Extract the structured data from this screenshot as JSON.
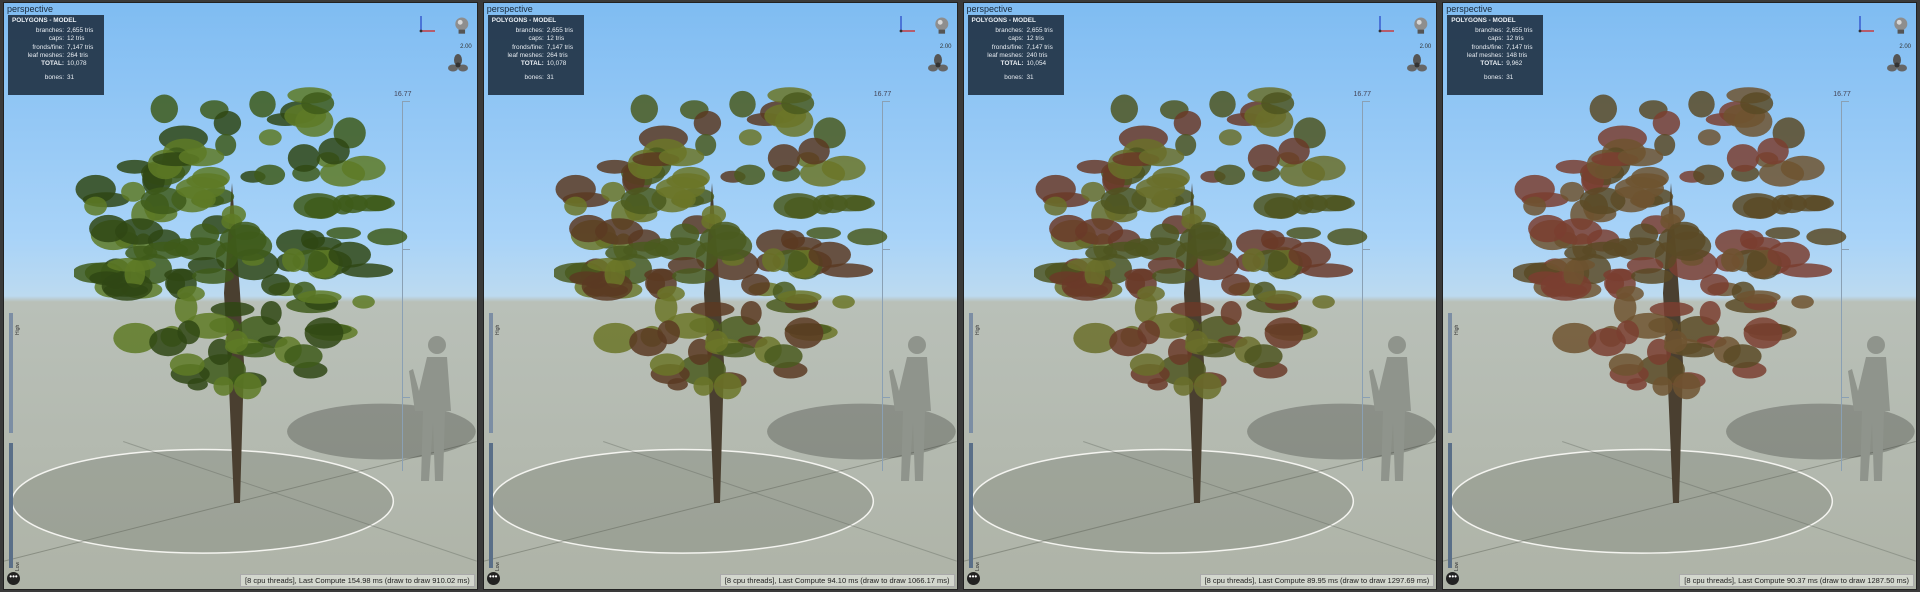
{
  "viewports": [
    {
      "title": "perspective",
      "stats": {
        "header": "POLYGONS - MODEL",
        "rows": [
          {
            "k": "branches:",
            "v": "2,655 tris"
          },
          {
            "k": "caps:",
            "v": "12 tris"
          },
          {
            "k": "fronds/fine:",
            "v": "7,147 tris"
          },
          {
            "k": "leaf meshes:",
            "v": "264 tris"
          },
          {
            "k": "TOTAL:",
            "v": "10,078"
          }
        ],
        "bones_k": "bones:",
        "bones_v": "31"
      },
      "zoom": "2.00",
      "ruler_value": "16.77",
      "high_label": "High",
      "low_label": "Low",
      "status": "[8 cpu threads], Last Compute 154.98 ms (draw to draw 910.02 ms)",
      "foliage_colors": [
        "#3e5a1a",
        "#5e7a26",
        "#2f4714"
      ]
    },
    {
      "title": "perspective",
      "stats": {
        "header": "POLYGONS - MODEL",
        "rows": [
          {
            "k": "branches:",
            "v": "2,655 tris"
          },
          {
            "k": "caps:",
            "v": "12 tris"
          },
          {
            "k": "fronds/fine:",
            "v": "7,147 tris"
          },
          {
            "k": "leaf meshes:",
            "v": "264 tris"
          },
          {
            "k": "TOTAL:",
            "v": "10,078"
          }
        ],
        "bones_k": "bones:",
        "bones_v": "31"
      },
      "zoom": "2.00",
      "ruler_value": "16.77",
      "high_label": "High",
      "low_label": "Low",
      "status": "[8 cpu threads], Last Compute 94.10 ms (draw to draw 1066.17 ms)",
      "foliage_colors": [
        "#4a5a1e",
        "#6b7628",
        "#5a3a22"
      ]
    },
    {
      "title": "perspective",
      "stats": {
        "header": "POLYGONS - MODEL",
        "rows": [
          {
            "k": "branches:",
            "v": "2,655 tris"
          },
          {
            "k": "caps:",
            "v": "12 tris"
          },
          {
            "k": "fronds/fine:",
            "v": "7,147 tris"
          },
          {
            "k": "leaf meshes:",
            "v": "240 tris"
          },
          {
            "k": "TOTAL:",
            "v": "10,054"
          }
        ],
        "bones_k": "bones:",
        "bones_v": "31"
      },
      "zoom": "2.00",
      "ruler_value": "16.77",
      "high_label": "High",
      "low_label": "Low",
      "status": "[8 cpu threads], Last Compute 89.95 ms (draw to draw 1297.69 ms)",
      "foliage_colors": [
        "#4d5520",
        "#6a6e2a",
        "#6a3a28"
      ]
    },
    {
      "title": "perspective",
      "stats": {
        "header": "POLYGONS - MODEL",
        "rows": [
          {
            "k": "branches:",
            "v": "2,655 tris"
          },
          {
            "k": "caps:",
            "v": "12 tris"
          },
          {
            "k": "fronds/fine:",
            "v": "7,147 tris"
          },
          {
            "k": "leaf meshes:",
            "v": "148 tris"
          },
          {
            "k": "TOTAL:",
            "v": "9,962"
          }
        ],
        "bones_k": "bones:",
        "bones_v": "31"
      },
      "zoom": "2.00",
      "ruler_value": "16.77",
      "high_label": "High",
      "low_label": "Low",
      "status": "[8 cpu threads], Last Compute 90.37 ms (draw to draw 1287.50 ms)",
      "foliage_colors": [
        "#5a4a26",
        "#6e5430",
        "#7a3e30"
      ]
    }
  ]
}
